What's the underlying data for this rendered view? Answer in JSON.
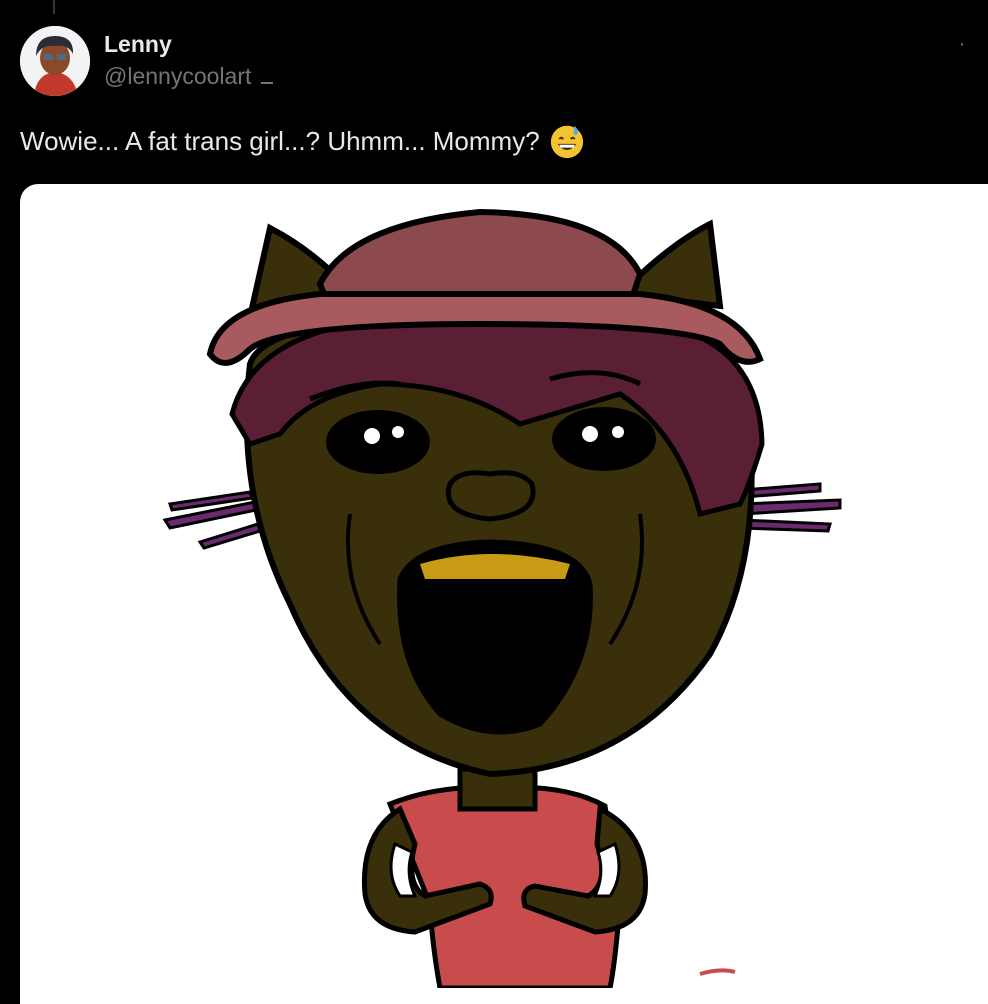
{
  "tweet": {
    "author": {
      "display_name": "Lenny",
      "handle": "@lennycoolart"
    },
    "text": "Wowie... A fat trans girl...? Uhmm... Mommy?",
    "emoji": "grinning-face-with-sweat",
    "more_label": "·"
  },
  "colors": {
    "background": "#000000",
    "primary_text": "#e7e9ea",
    "secondary_text": "#71767b",
    "media_background": "#ffffff",
    "skin": "#3a2f0b",
    "hat": "#8c4a4e",
    "hair": "#5a1f35",
    "shirt": "#c94c4c",
    "whiskers": "#6a2a6e",
    "teeth": "#c89a16"
  }
}
